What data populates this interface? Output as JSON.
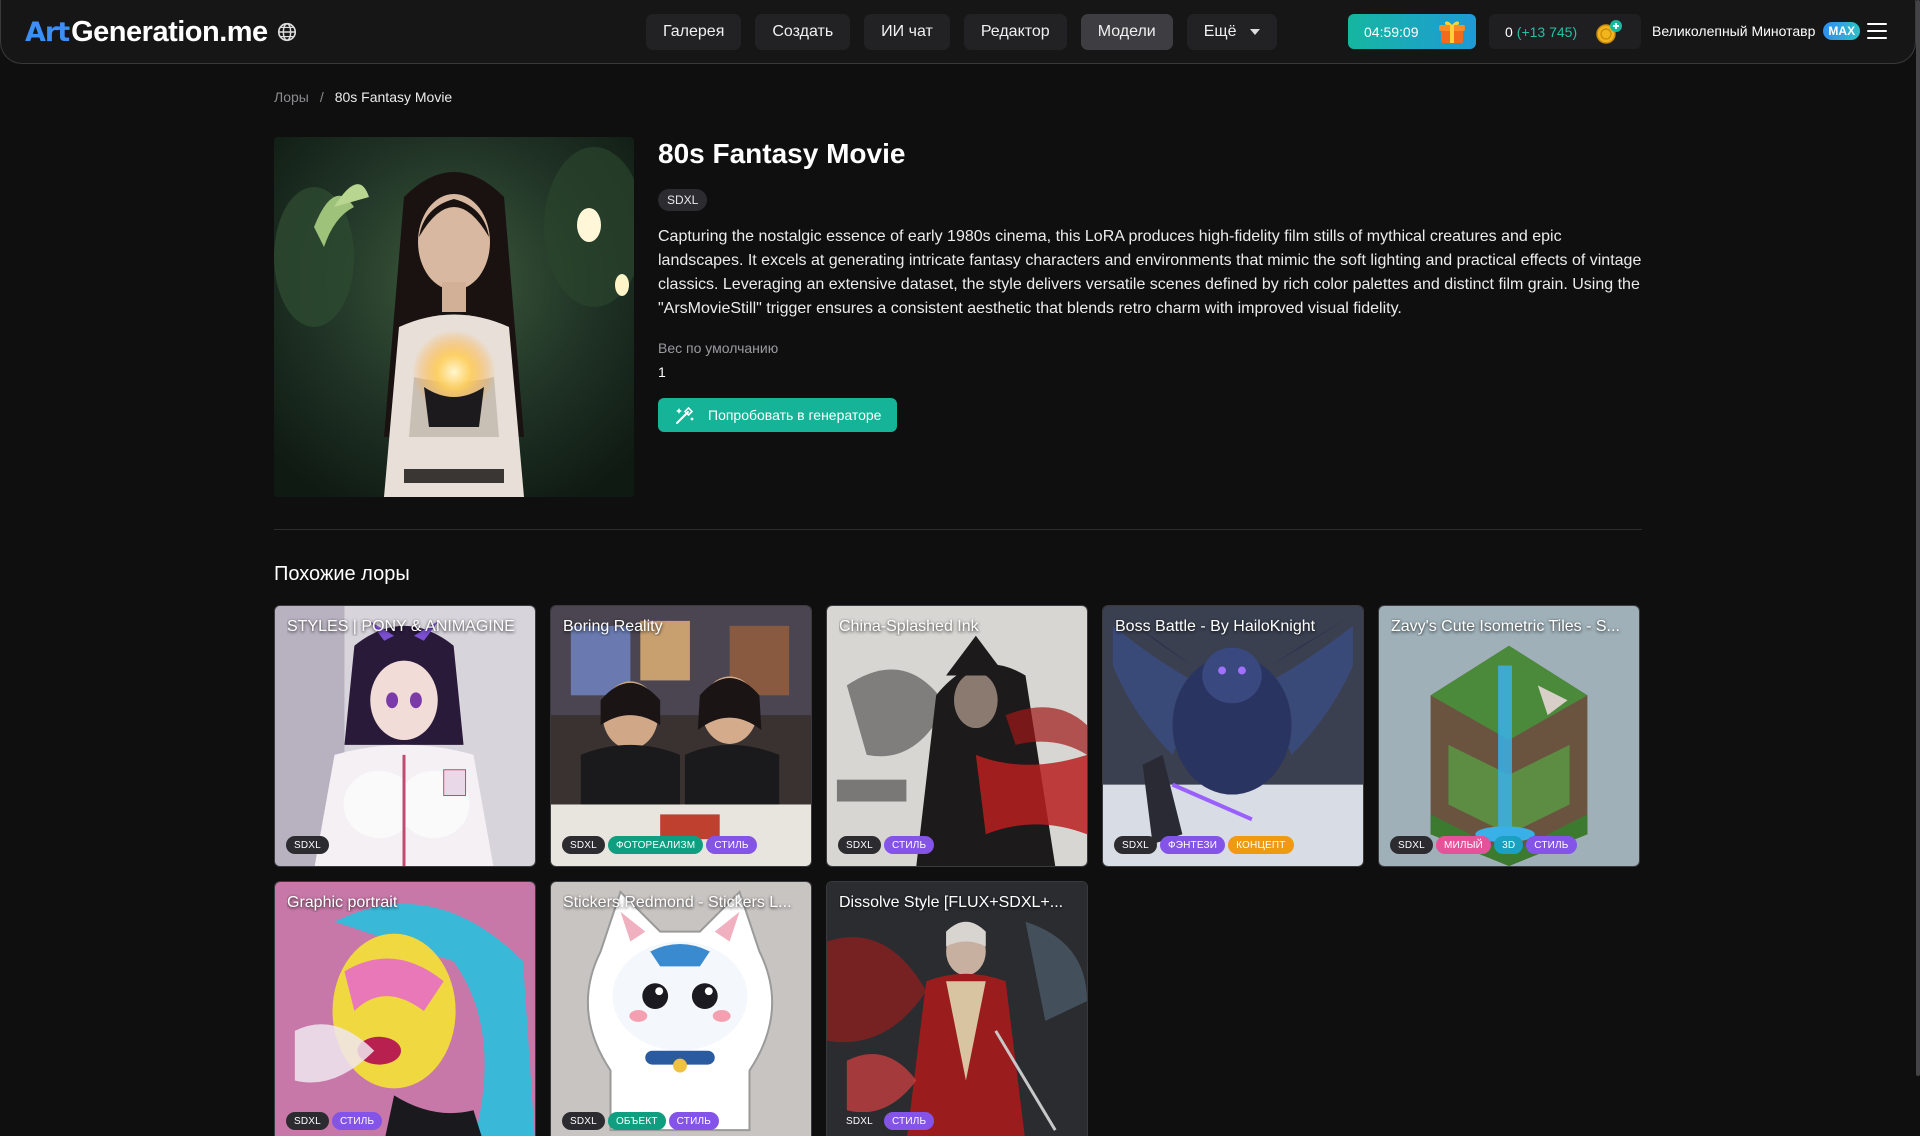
{
  "header": {
    "logo_art": "Art",
    "logo_text": "Generation.me",
    "nav": [
      "Галерея",
      "Создать",
      "ИИ чат",
      "Редактор",
      "Модели",
      "Ещё"
    ],
    "active_nav": "Модели",
    "timer": "04:59:09",
    "coins": "0",
    "coins_bonus": "(+13 745)",
    "user_name": "Великолепный Минотавр",
    "user_badge": "MAX"
  },
  "breadcrumb": {
    "parent": "Лоры",
    "separator": "/",
    "current": "80s Fantasy Movie"
  },
  "lora": {
    "title": "80s Fantasy Movie",
    "base_model": "SDXL",
    "description": "Capturing the nostalgic essence of early 1980s cinema, this LoRA produces high-fidelity film stills of mythical creatures and epic landscapes. It excels at generating intricate fantasy characters and environments that mimic the soft lighting and practical effects of vintage classics. Leveraging an extensive dataset, the style delivers versatile scenes defined by rich color palettes and distinct film grain. Using the \"ArsMovieStill\" trigger ensures a consistent aesthetic that blends retro charm with improved visual fidelity.",
    "weight_label": "Вес по умолчанию",
    "weight_value": "1",
    "try_button": "Попробовать в генераторе"
  },
  "similar": {
    "title": "Похожие лоры",
    "cards": [
      {
        "title": "STYLES | PONY & ANIMAGINE",
        "tags": [
          {
            "label": "SDXL",
            "color": "base"
          }
        ]
      },
      {
        "title": "Boring Reality",
        "tags": [
          {
            "label": "SDXL",
            "color": "base"
          },
          {
            "label": "ФОТОРЕАЛИЗМ",
            "color": "green"
          },
          {
            "label": "СТИЛЬ",
            "color": "purple"
          }
        ]
      },
      {
        "title": "China-Splashed Ink",
        "tags": [
          {
            "label": "SDXL",
            "color": "base"
          },
          {
            "label": "СТИЛЬ",
            "color": "purple"
          }
        ]
      },
      {
        "title": "Boss Battle - By HailoKnight",
        "tags": [
          {
            "label": "SDXL",
            "color": "base"
          },
          {
            "label": "ФЭНТЕЗИ",
            "color": "purple"
          },
          {
            "label": "КОНЦЕПТ",
            "color": "orange"
          }
        ]
      },
      {
        "title": "Zavy's Cute Isometric Tiles - S...",
        "tags": [
          {
            "label": "SDXL",
            "color": "base"
          },
          {
            "label": "МИЛЫЙ",
            "color": "pink"
          },
          {
            "label": "3D",
            "color": "teal"
          },
          {
            "label": "СТИЛЬ",
            "color": "purple"
          }
        ]
      },
      {
        "title": "Graphic portrait",
        "tags": [
          {
            "label": "SDXL",
            "color": "base"
          },
          {
            "label": "СТИЛЬ",
            "color": "purple"
          }
        ]
      },
      {
        "title": "Stickers.Redmond - Stickers L...",
        "tags": [
          {
            "label": "SDXL",
            "color": "base"
          },
          {
            "label": "ОБЪЕКТ",
            "color": "green"
          },
          {
            "label": "СТИЛЬ",
            "color": "purple"
          }
        ]
      },
      {
        "title": "Dissolve Style [FLUX+SDXL+...",
        "tags": [
          {
            "label": "SDXL",
            "color": "base"
          },
          {
            "label": "СТИЛЬ",
            "color": "purple"
          }
        ]
      }
    ]
  },
  "colors": {
    "accent_green": "#15b397",
    "brand_blue": "#3b8ff5",
    "background": "#0f0f10"
  }
}
